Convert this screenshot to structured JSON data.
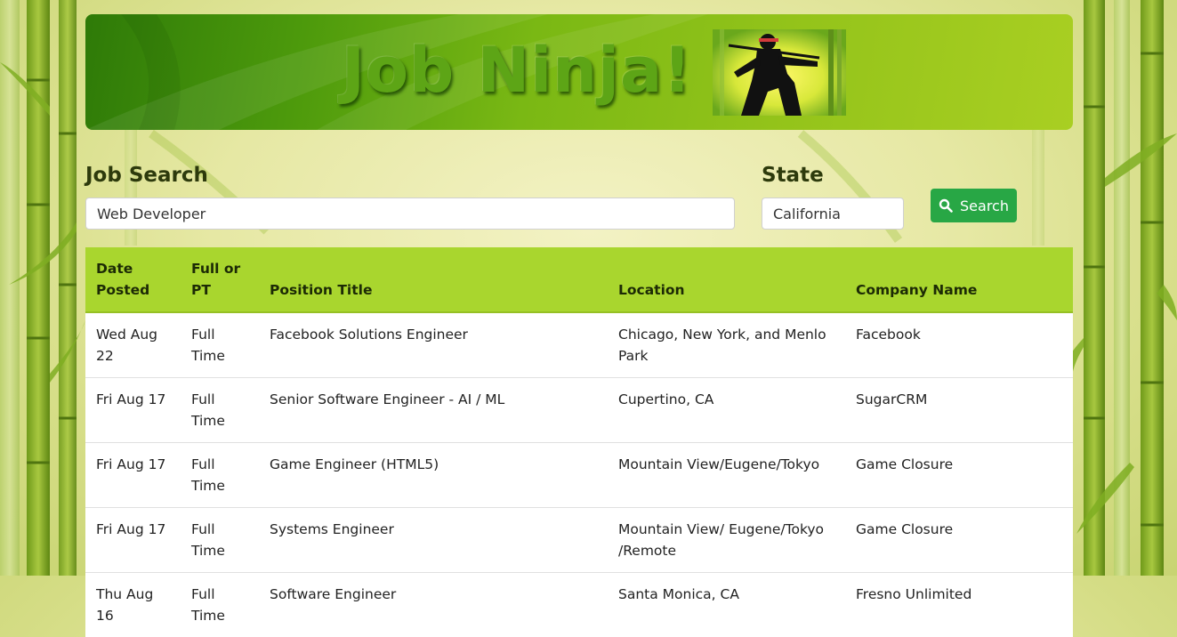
{
  "header": {
    "logo_text": "Job Ninja!",
    "image_alt": "ninja-with-swords"
  },
  "search": {
    "job_label": "Job Search",
    "job_value": "Web Developer",
    "state_label": "State",
    "state_value": "California",
    "button_label": "Search",
    "button_icon": "search-icon"
  },
  "table": {
    "headers": [
      "Date Posted",
      "Full or PT",
      "Position Title",
      "Location",
      "Company Name"
    ],
    "rows": [
      [
        "Wed Aug 22",
        "Full Time",
        "Facebook Solutions Engineer",
        "Chicago, New York, and Menlo Park",
        "Facebook"
      ],
      [
        "Fri Aug 17",
        "Full Time",
        "Senior Software Engineer - AI / ML",
        "Cupertino, CA",
        "SugarCRM"
      ],
      [
        "Fri Aug 17",
        "Full Time",
        "Game Engineer (HTML5)",
        "Mountain View/Eugene/Tokyo",
        "Game Closure"
      ],
      [
        "Fri Aug 17",
        "Full Time",
        "Systems Engineer",
        "Mountain View/ Eugene/Tokyo /Remote",
        "Game Closure"
      ],
      [
        "Thu Aug 16",
        "Full Time",
        "Software Engineer",
        "Santa Monica, CA",
        "Fresno Unlimited"
      ]
    ]
  },
  "colors": {
    "header_green": "#4d9a0c",
    "table_header": "#a9d62e",
    "button": "#28a745"
  }
}
